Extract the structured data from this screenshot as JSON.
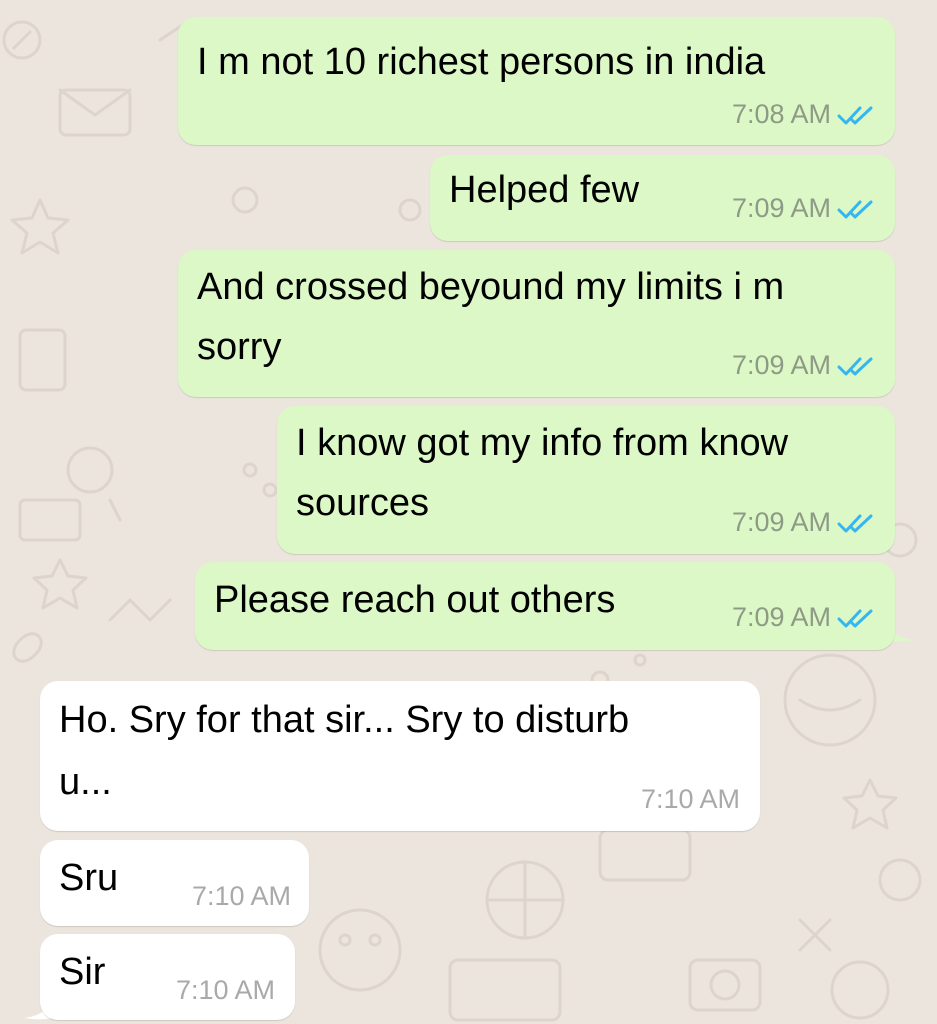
{
  "messages": [
    {
      "direction": "outgoing",
      "text": "I m not 10 richest persons in india",
      "time": "7:08 AM",
      "status_icon": "read-double-check-icon"
    },
    {
      "direction": "outgoing",
      "text": "Helped few",
      "time": "7:09 AM",
      "status_icon": "read-double-check-icon"
    },
    {
      "direction": "outgoing",
      "lines": [
        "And crossed beyound my limits i m",
        "sorry"
      ],
      "time": "7:09 AM",
      "status_icon": "read-double-check-icon"
    },
    {
      "direction": "outgoing",
      "lines": [
        "I know got my info from know",
        "sources"
      ],
      "time": "7:09 AM",
      "status_icon": "read-double-check-icon"
    },
    {
      "direction": "outgoing",
      "text": "Please reach out others",
      "time": "7:09 AM",
      "status_icon": "read-double-check-icon"
    },
    {
      "direction": "incoming",
      "lines": [
        "Ho. Sry for that sir... Sry to disturb",
        "u..."
      ],
      "time": "7:10 AM"
    },
    {
      "direction": "incoming",
      "text": "Sru",
      "time": "7:10 AM"
    },
    {
      "direction": "incoming",
      "text": "Sir",
      "time": "7:10 AM"
    }
  ],
  "colors": {
    "background": "#ECE5DD",
    "outgoing_bubble": "#DCF8C6",
    "incoming_bubble": "#FFFFFF",
    "read_tick": "#34B7F1"
  }
}
